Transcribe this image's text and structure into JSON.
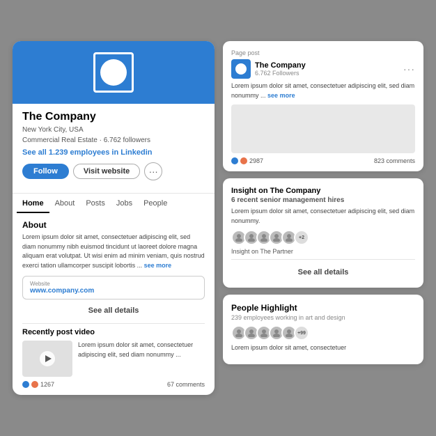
{
  "left": {
    "banner_bg": "#2d7dd2",
    "company_name": "The Company",
    "location": "New York City, USA",
    "industry": "Commercial Real Estate · 6.762 followers",
    "employees_text": "See all 1.239 employees in Linkedin",
    "follow_label": "Follow",
    "visit_label": "Visit website",
    "more_icon": "···",
    "tabs": [
      "Home",
      "About",
      "Posts",
      "Jobs",
      "People"
    ],
    "active_tab": "Home",
    "about_title": "About",
    "about_text": "Lorem ipsum dolor sit amet, consectetuer adipiscing elit, sed diam nonummy nibh euismod tincidunt ut laoreet dolore magna aliquam erat volutpat. Ut wisi enim ad minim veniam, quis nostrud exerci tation ullamcorper suscipit lobortis ...",
    "see_more_1": "see more",
    "website_label": "Website",
    "website_url": "www.company.com",
    "see_all_details": "See all details",
    "video_section_title": "Recently post video",
    "video_text": "Lorem ipsum dolor sit amet, consectetuer adipiscing elit, sed diam nonummy ...",
    "reaction_dot1": "#2d7dd2",
    "reaction_dot2": "#e8734a",
    "reaction_count": "1267",
    "comments_count": "67 comments"
  },
  "right": {
    "card1": {
      "tag": "Page post",
      "company_name": "The Company",
      "followers": "6.762 Followers",
      "text": "Lorem ipsum dolor sit amet, consectetuer adipiscing elit, sed diam nonummy ...",
      "see_more": "see more",
      "reaction_dot1": "#2d7dd2",
      "reaction_dot2": "#e8734a",
      "reaction_count": "2987",
      "comments_count": "823 comments"
    },
    "card2": {
      "insight_title": "Insight on The Company",
      "insight_subtitle": "6 recent senior management hires",
      "insight_text": "Lorem ipsum dolor sit amet, consectetuer adipiscing elit, sed diam nonummy.",
      "avatar_count": "+2",
      "partner_label": "Insight on The Partner",
      "see_all_label": "See all details"
    },
    "card3": {
      "people_title": "People Highlight",
      "people_subtitle": "239 employees working in art and design",
      "avatar_extra": "+99",
      "people_text": "Lorem ipsum dolor sit amet, consectetuer"
    }
  }
}
